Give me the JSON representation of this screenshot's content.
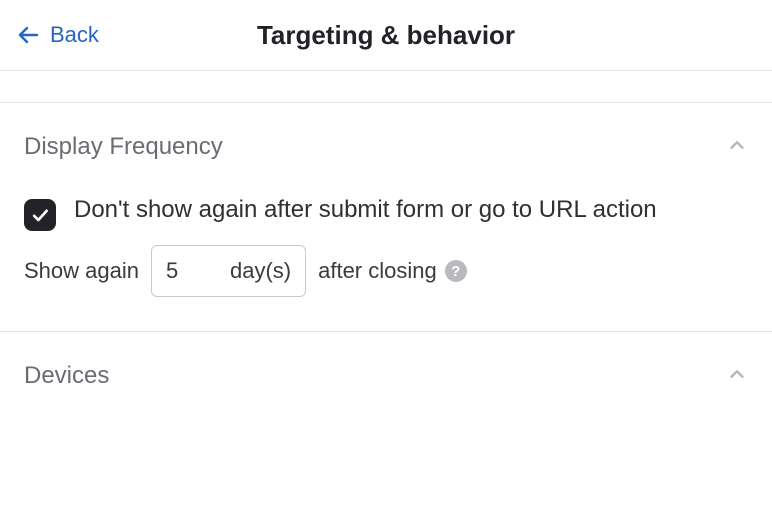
{
  "header": {
    "back_label": "Back",
    "title": "Targeting & behavior"
  },
  "sections": {
    "display_frequency": {
      "title": "Display Frequency",
      "option_dont_show_label": "Don't show again after submit form or go to URL action",
      "option_dont_show_checked": true,
      "show_again_prefix": "Show again",
      "show_again_value": "5",
      "show_again_unit": "day(s)",
      "show_again_suffix": "after closing",
      "help_glyph": "?"
    },
    "devices": {
      "title": "Devices"
    }
  }
}
